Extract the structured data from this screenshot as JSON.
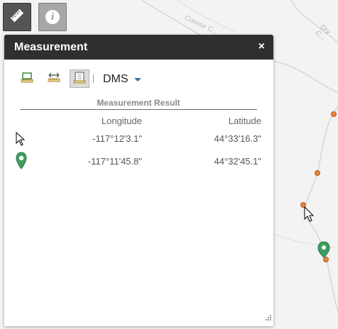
{
  "map": {
    "road_labels": [
      "Connor C...",
      "Dry C..."
    ]
  },
  "toolbar_top": {
    "measure_icon": "ruler-icon",
    "info_icon": "info-icon",
    "info_glyph": "i"
  },
  "panel": {
    "title": "Measurement",
    "close_glyph": "×",
    "tools": [
      {
        "name": "area-tool",
        "icon": "area-ruler-icon"
      },
      {
        "name": "distance-tool",
        "icon": "distance-ruler-icon"
      },
      {
        "name": "location-tool",
        "icon": "location-grid-icon",
        "active": true
      }
    ],
    "unit": "DMS",
    "result_heading": "Measurement Result",
    "columns": {
      "longitude": "Longitude",
      "latitude": "Latitude"
    },
    "rows": [
      {
        "icon": "cursor-icon",
        "longitude": "-117°12'3.1\"",
        "latitude": "44°33'16.3\""
      },
      {
        "icon": "map-pin-icon",
        "longitude": "-117°11'45.8\"",
        "latitude": "44°32'45.1\""
      }
    ]
  },
  "colors": {
    "header_bg": "#2f2f2f",
    "pin_green": "#3e9e5e",
    "point_orange": "#e8843a"
  }
}
